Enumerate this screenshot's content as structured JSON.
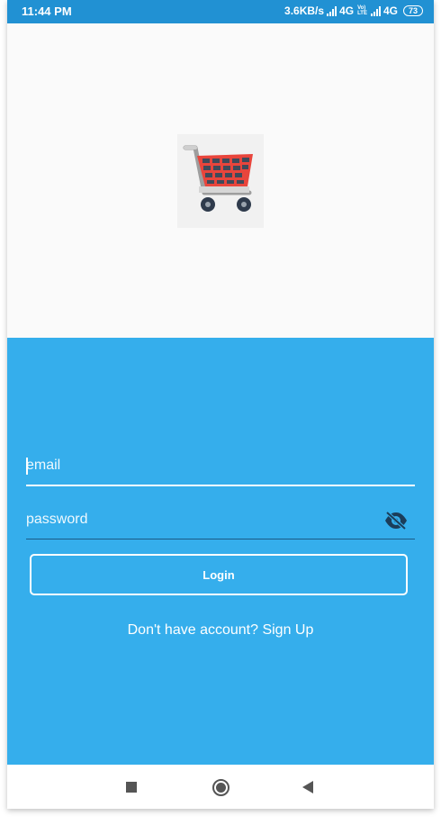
{
  "status_bar": {
    "time": "11:44 PM",
    "speed": "3.6KB/s",
    "network_1": "4G",
    "volte_top": "Vo)",
    "volte_bottom": "LTE",
    "network_2": "4G",
    "battery": "73"
  },
  "hero": {
    "logo_icon": "shopping-cart-icon"
  },
  "form": {
    "email_placeholder": "email",
    "password_placeholder": "password",
    "visibility_icon": "eye-off-icon",
    "login_label": "Login",
    "signup_text": "Don't have account? Sign Up"
  },
  "nav": {
    "recent_icon": "square-icon",
    "home_icon": "circle-icon",
    "back_icon": "triangle-back-icon"
  },
  "colors": {
    "status_bar": "#2191d3",
    "panel": "#35aeec",
    "background": "#fafafa",
    "cart_basket": "#e8453c",
    "nav_icons": "#555555"
  }
}
